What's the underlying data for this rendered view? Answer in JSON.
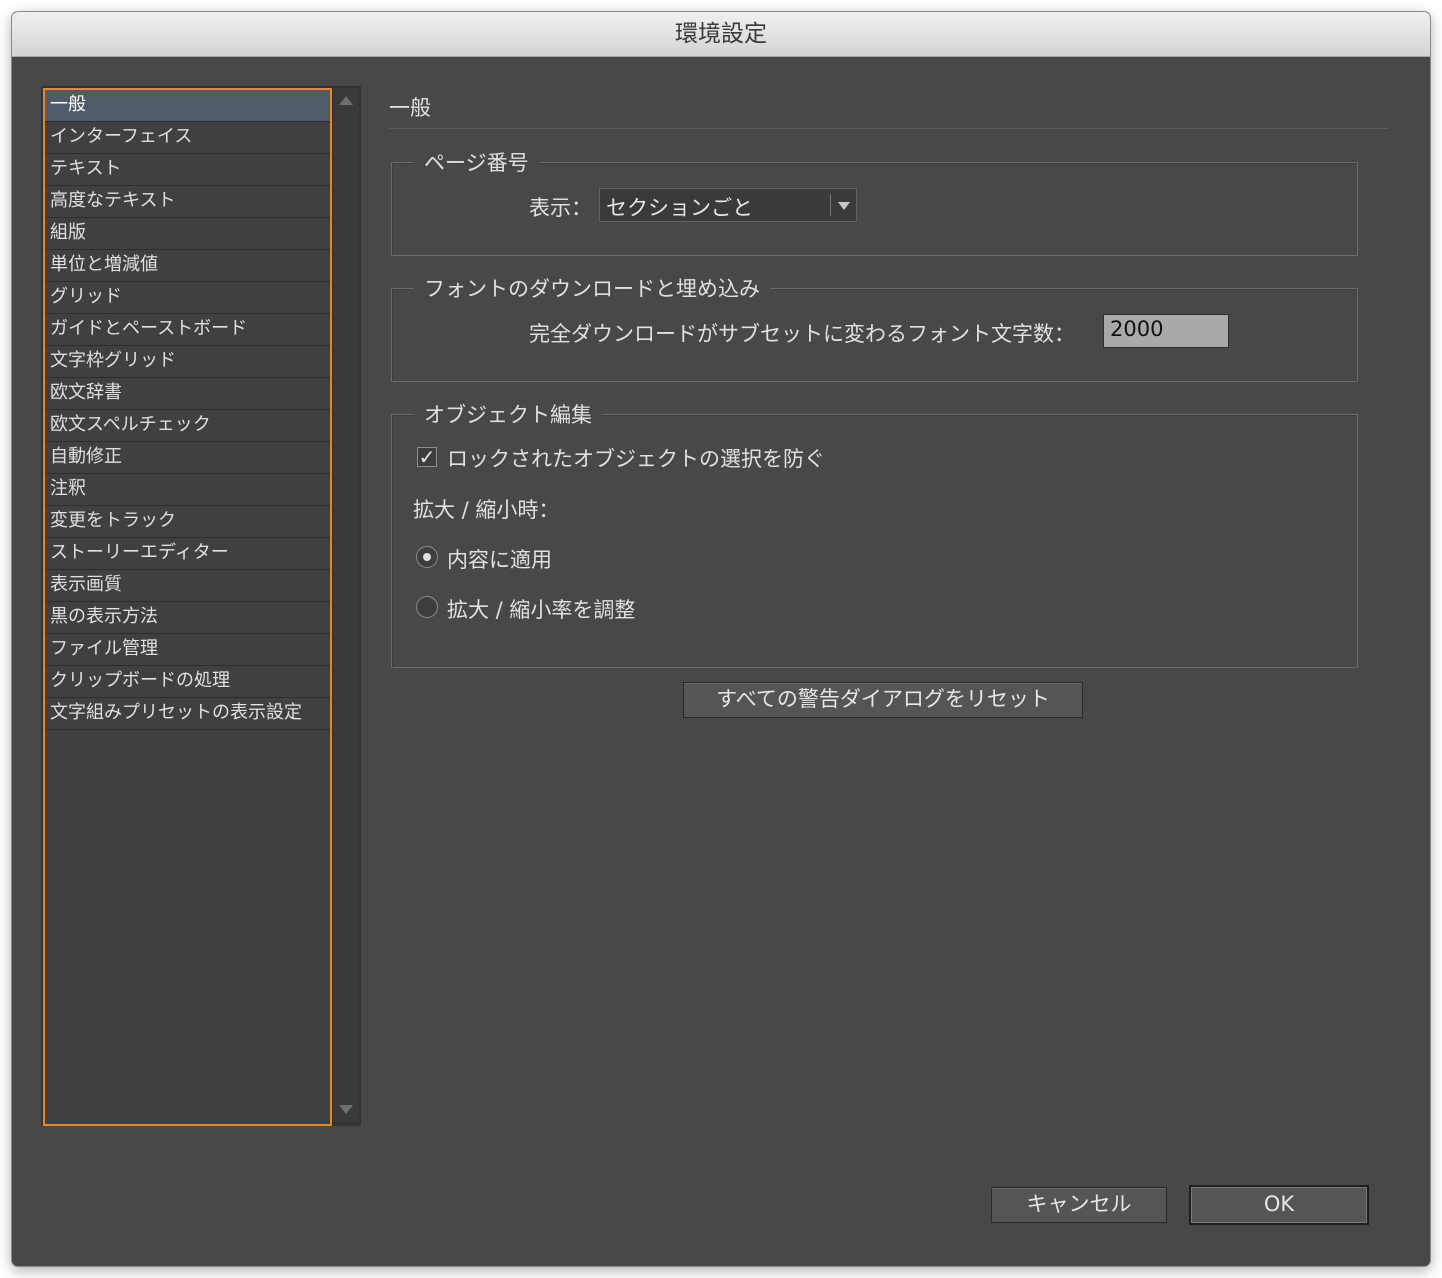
{
  "window": {
    "title": "環境設定"
  },
  "sidebar": {
    "items": [
      {
        "label": "一般",
        "selected": true
      },
      {
        "label": "インターフェイス"
      },
      {
        "label": "テキスト"
      },
      {
        "label": "高度なテキスト"
      },
      {
        "label": "組版"
      },
      {
        "label": "単位と増減値"
      },
      {
        "label": "グリッド"
      },
      {
        "label": "ガイドとペーストボード"
      },
      {
        "label": "文字枠グリッド"
      },
      {
        "label": "欧文辞書"
      },
      {
        "label": "欧文スペルチェック"
      },
      {
        "label": "自動修正"
      },
      {
        "label": "注釈"
      },
      {
        "label": "変更をトラック"
      },
      {
        "label": "ストーリーエディター"
      },
      {
        "label": "表示画質"
      },
      {
        "label": "黒の表示方法"
      },
      {
        "label": "ファイル管理"
      },
      {
        "label": "クリップボードの処理"
      },
      {
        "label": "文字組みプリセットの表示設定"
      }
    ]
  },
  "main": {
    "section_title": "一般",
    "page_number": {
      "legend": "ページ番号",
      "view_label": "表示：",
      "view_value": "セクションごと"
    },
    "font_download": {
      "legend": "フォントのダウンロードと埋め込み",
      "threshold_label": "完全ダウンロードがサブセットに変わるフォント文字数：",
      "threshold_value": "2000"
    },
    "object_edit": {
      "legend": "オブジェクト編集",
      "prevent_locked_label": "ロックされたオブジェクトの選択を防ぐ",
      "prevent_locked_checked": true,
      "scaling_label": "拡大 / 縮小時：",
      "apply_to_content_label": "内容に適用",
      "adjust_scale_label": "拡大 / 縮小率を調整",
      "selected_option": "内容に適用"
    },
    "reset_dialogs_label": "すべての警告ダイアログをリセット"
  },
  "footer": {
    "cancel_label": "キャンセル",
    "ok_label": "OK"
  },
  "colors": {
    "dialog_bg": "#484848",
    "sidebar_focus_border": "#e8862a",
    "selected_item_bg": "#4f5a6a"
  }
}
